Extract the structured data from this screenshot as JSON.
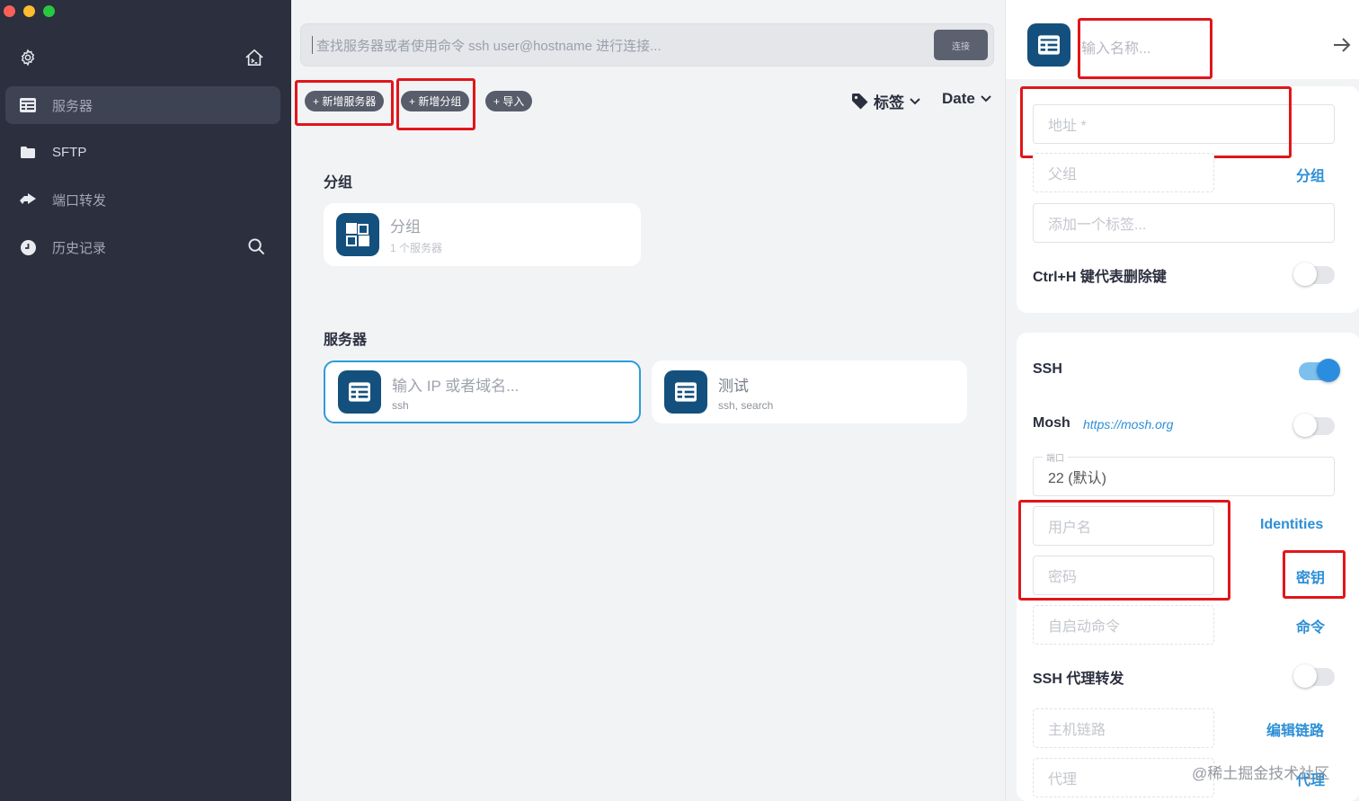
{
  "sidebar": {
    "items": [
      {
        "label": "服务器",
        "icon": "server-icon"
      },
      {
        "label": "SFTP",
        "icon": "folder-icon"
      },
      {
        "label": "端口转发",
        "icon": "forward-arrow-icon"
      },
      {
        "label": "历史记录",
        "icon": "clock-icon"
      }
    ]
  },
  "search": {
    "placeholder": "查找服务器或者使用命令 ssh user@hostname 进行连接...",
    "connect_label": "连接"
  },
  "toolbar": {
    "add_server": "+ 新增服务器",
    "add_group": "+ 新增分组",
    "import": "+ 导入",
    "tags_label": "标签",
    "sort_label": "Date"
  },
  "groups": {
    "title": "分组",
    "items": [
      {
        "name": "分组",
        "count": "1 个服务器"
      }
    ]
  },
  "servers": {
    "title": "服务器",
    "items": [
      {
        "name": "输入 IP 或者域名...",
        "tags": "ssh"
      },
      {
        "name": "测试",
        "tags": "ssh, search"
      }
    ]
  },
  "editor": {
    "name_placeholder": "输入名称...",
    "address_placeholder": "地址 *",
    "parent_group_placeholder": "父组",
    "group_link": "分组",
    "tag_placeholder": "添加一个标签...",
    "ctrl_h_label": "Ctrl+H 键代表删除键",
    "ssh_label": "SSH",
    "mosh_label": "Mosh",
    "mosh_url": "https://mosh.org",
    "port_legend": "端口",
    "port_value": "22 (默认)",
    "username_placeholder": "用户名",
    "identities_link": "Identities",
    "password_placeholder": "密码",
    "key_link": "密钥",
    "startup_placeholder": "自启动命令",
    "command_link": "命令",
    "ssh_proxy_label": "SSH 代理转发",
    "host_chain_placeholder": "主机链路",
    "edit_chain_link": "编辑链路",
    "proxy_placeholder": "代理",
    "proxy_link": "代理"
  },
  "colors": {
    "sidebar_bg": "#2b2f3e",
    "accent": "#2c8fd6",
    "badge": "#14507d",
    "highlight": "#e0161b"
  },
  "watermark": "@稀土掘金技术社区"
}
